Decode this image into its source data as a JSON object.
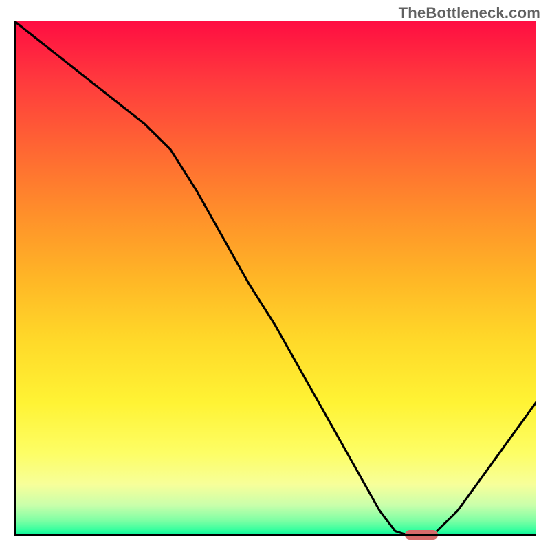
{
  "watermark": "TheBottleneck.com",
  "chart_data": {
    "type": "line",
    "title": "",
    "xlabel": "",
    "ylabel": "",
    "xlim": [
      0,
      100
    ],
    "ylim": [
      0,
      100
    ],
    "x": [
      0,
      5,
      10,
      15,
      20,
      25,
      30,
      35,
      40,
      45,
      50,
      55,
      60,
      65,
      70,
      73,
      76,
      80,
      85,
      90,
      95,
      100
    ],
    "values": [
      100,
      96,
      92,
      88,
      84,
      80,
      75,
      67,
      58,
      49,
      41,
      32,
      23,
      14,
      5,
      1,
      0,
      0,
      5,
      12,
      19,
      26
    ],
    "optimum_x": 78,
    "optimum_y": 0,
    "gradient": {
      "top_color": "#ff0d42",
      "mid_color": "#ffd929",
      "bottom_color": "#00ef9a"
    },
    "marker_color": "#d86a6a"
  }
}
